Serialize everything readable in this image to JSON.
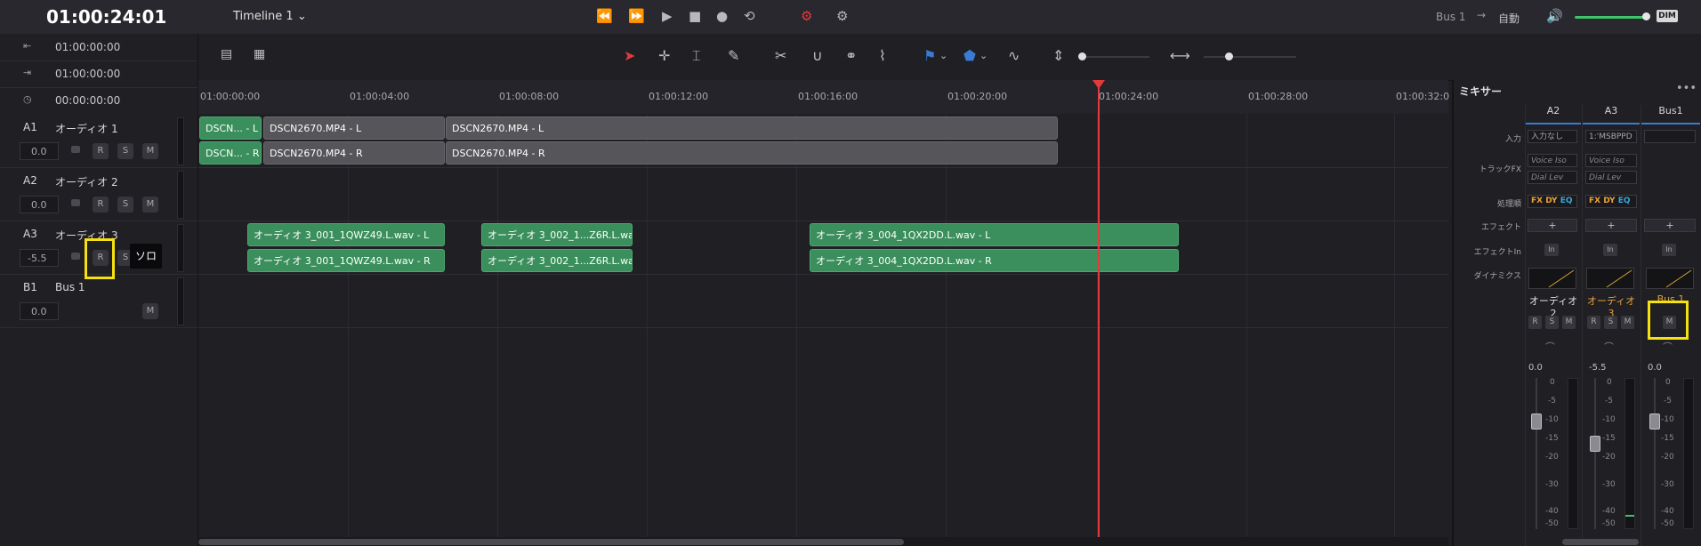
{
  "topbar": {
    "timecode": "01:00:24:01",
    "timeline_name": "Timeline 1",
    "bus_label": "Bus 1",
    "arrow": "→",
    "auto_label": "自動",
    "dim_label": "DIM"
  },
  "header_rows": [
    {
      "icon": "in-point-icon",
      "glyph": "⇤",
      "time": "01:00:00:00"
    },
    {
      "icon": "out-point-icon",
      "glyph": "⇥",
      "time": "01:00:00:00"
    },
    {
      "icon": "duration-icon",
      "glyph": "◷",
      "time": "00:00:00:00"
    }
  ],
  "ruler": {
    "ticks": [
      "01:00:00:00",
      "01:00:04:00",
      "01:00:08:00",
      "01:00:12:00",
      "01:00:16:00",
      "01:00:20:00",
      "01:00:24:00",
      "01:00:28:00",
      "01:00:32:0"
    ]
  },
  "tracks": [
    {
      "id": "A1",
      "name": "オーディオ 1",
      "volume": "0.0",
      "r": "R",
      "s": "S",
      "m": "M"
    },
    {
      "id": "A2",
      "name": "オーディオ 2",
      "volume": "0.0",
      "r": "R",
      "s": "S",
      "m": "M"
    },
    {
      "id": "A3",
      "name": "オーディオ 3",
      "volume": "-5.5",
      "r": "R",
      "s": "S",
      "m": "M"
    },
    {
      "id": "B1",
      "name": "Bus 1",
      "volume": "0.0",
      "m": "M"
    }
  ],
  "tooltip": "ソロ",
  "clips": {
    "a1_l": [
      "DSCN... - L",
      "DSCN2670.MP4 - L",
      "DSCN2670.MP4 - L"
    ],
    "a1_r": [
      "DSCN... - R",
      "DSCN2670.MP4 - R",
      "DSCN2670.MP4 - R"
    ],
    "a3_l": [
      "オーディオ 3_001_1QWZ49.L.wav - L",
      "オーディオ 3_002_1...Z6R.L.wav - L",
      "オーディオ 3_004_1QX2DD.L.wav - L"
    ],
    "a3_r": [
      "オーディオ 3_001_1QWZ49.L.wav - R",
      "オーディオ 3_002_1...Z6R.L.wav - R",
      "オーディオ 3_004_1QX2DD.L.wav - R"
    ]
  },
  "mixer": {
    "title": "ミキサー",
    "more": "•••",
    "row_labels": {
      "input": "入力",
      "track_fx": "トラックFX",
      "order": "処理順",
      "effects": "エフェクト",
      "effects_in": "エフェクトIn",
      "dynamics": "ダイナミクス"
    },
    "columns": [
      {
        "head": "A2",
        "input": "入力なし",
        "fx1": "Voice Iso",
        "fx2": "Dial Lev",
        "order": [
          "FX",
          "DY",
          "EQ"
        ],
        "plus": "+",
        "in": "In",
        "name": "オーディオ 2",
        "r": "R",
        "s": "S",
        "m": "M",
        "value": "0.0"
      },
      {
        "head": "A3",
        "input": "1:'MSBPPD",
        "fx1": "Voice Iso",
        "fx2": "Dial Lev",
        "order": [
          "FX",
          "DY",
          "EQ"
        ],
        "plus": "+",
        "in": "In",
        "name": "オーディオ 3",
        "r": "R",
        "s": "S",
        "m": "M",
        "value": "-5.5"
      },
      {
        "head": "Bus1",
        "input": "",
        "plus": "+",
        "in": "In",
        "name": "Bus 1",
        "m": "M",
        "value": "0.0"
      }
    ],
    "scale": [
      "0",
      "-5",
      "-10",
      "-15",
      "-20",
      "-30",
      "-40",
      "-50"
    ]
  },
  "colors": {
    "accent_blue": "#3a7bd5",
    "clip_green": "#3a8f5c",
    "playhead_red": "#e23b3b",
    "highlight_yellow": "#f5e10f"
  }
}
